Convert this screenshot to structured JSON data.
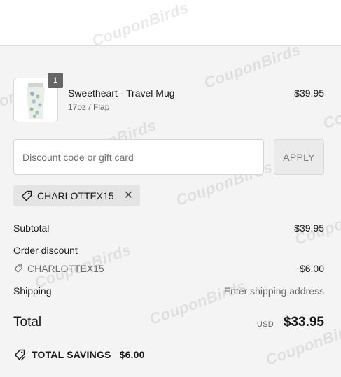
{
  "watermark": {
    "text": "CouponBirds"
  },
  "product": {
    "quantity": "1",
    "name": "Sweetheart - Travel Mug",
    "variant": "17oz / Flap",
    "price": "$39.95"
  },
  "discount": {
    "placeholder": "Discount code or gift card",
    "apply_label": "APPLY",
    "applied_code": "CHARLOTTEX15"
  },
  "summary": {
    "subtotal_label": "Subtotal",
    "subtotal_value": "$39.95",
    "order_discount_label": "Order discount",
    "discount_code": "CHARLOTTEX15",
    "discount_value": "−$6.00",
    "shipping_label": "Shipping",
    "shipping_value": "Enter shipping address",
    "total_label": "Total",
    "total_currency": "USD",
    "total_value": "$33.95"
  },
  "savings": {
    "label": "TOTAL SAVINGS",
    "value": "$6.00"
  },
  "icons": [
    "tag-icon",
    "close-icon",
    "product-image"
  ],
  "colors": {
    "background": "#f4f4f4",
    "chip": "#e4e4e4",
    "badge": "#666666",
    "text": "#1a1a1a",
    "muted": "#6b6b6b"
  }
}
